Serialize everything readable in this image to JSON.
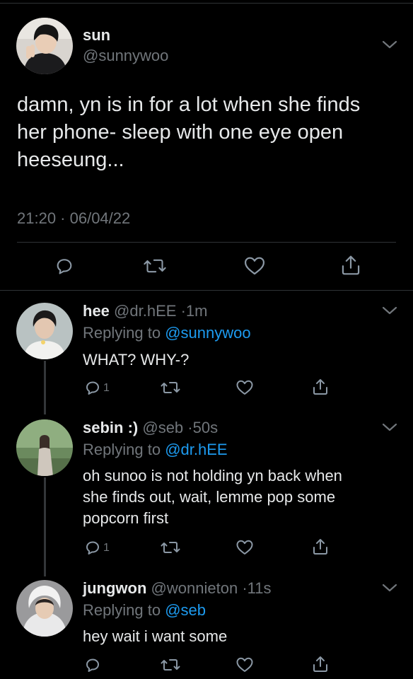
{
  "main_tweet": {
    "name": "sun",
    "handle": "@sunnywoo",
    "text": "damn, yn is in for a lot when she finds\nher phone- sleep with one eye open\nheeseung...",
    "timestamp": "21:20 · 06/04/22",
    "actions": [
      "reply-icon",
      "retweet-icon",
      "like-icon",
      "share-icon"
    ]
  },
  "replies": [
    {
      "name": "hee",
      "handle": "@dr.hEE",
      "age": "1m",
      "replying_label": "Replying to",
      "replying_to": "@sunnywoo",
      "text": "WHAT? WHY-?",
      "reply_count": "1"
    },
    {
      "name": "sebin :)",
      "handle": "@seb",
      "age": "50s",
      "replying_label": "Replying to",
      "replying_to": "@dr.hEE",
      "text": "oh sunoo is not holding yn back when\nshe finds out, wait, lemme pop some\npopcorn first",
      "reply_count": "1"
    },
    {
      "name": "jungwon",
      "handle": "@wonnieton",
      "age": "11s",
      "replying_label": "Replying to",
      "replying_to": "@seb",
      "text": "hey wait i want some",
      "reply_count": ""
    }
  ],
  "colors": {
    "background": "#000000",
    "text": "#e7e9ea",
    "muted": "#71767b",
    "accent": "#1d9bf0",
    "divider": "#2f3336"
  }
}
